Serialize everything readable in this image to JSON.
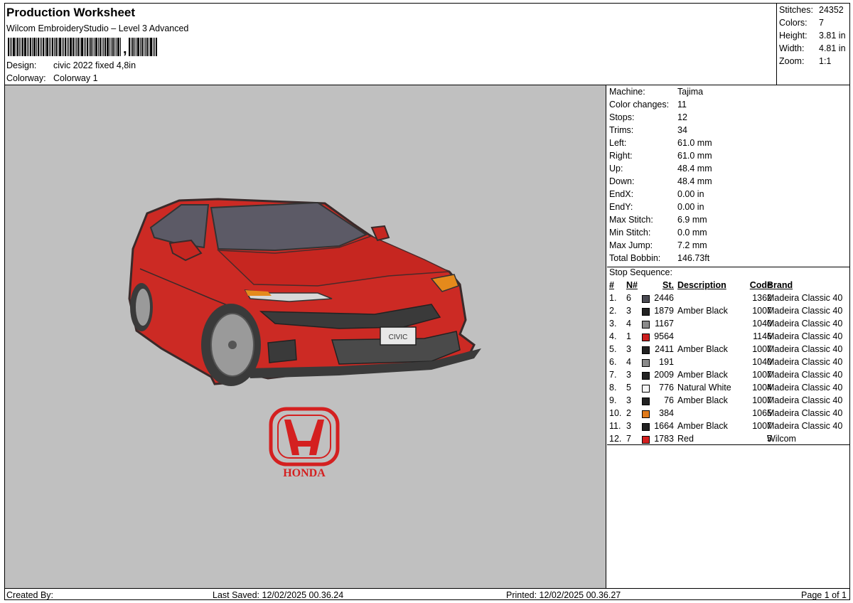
{
  "header": {
    "title": "Production Worksheet",
    "subtitle": "Wilcom EmbroideryStudio – Level 3 Advanced",
    "barcode_suffix": ",",
    "design_label": "Design:",
    "design_value": "civic 2022 fixed 4,8in",
    "colorway_label": "Colorway:",
    "colorway_value": "Colorway 1"
  },
  "stats": [
    {
      "label": "Stitches:",
      "value": "24352"
    },
    {
      "label": "Colors:",
      "value": "7"
    },
    {
      "label": "Height:",
      "value": "3.81 in"
    },
    {
      "label": "Width:",
      "value": "4.81 in"
    },
    {
      "label": "Zoom:",
      "value": "1:1"
    }
  ],
  "machine_info": [
    {
      "label": "Machine:",
      "value": "Tajima"
    },
    {
      "label": "Color changes:",
      "value": "11"
    },
    {
      "label": "Stops:",
      "value": "12"
    },
    {
      "label": "Trims:",
      "value": "34"
    },
    {
      "label": "Left:",
      "value": "61.0 mm"
    },
    {
      "label": "Right:",
      "value": "61.0 mm"
    },
    {
      "label": "Up:",
      "value": "48.4 mm"
    },
    {
      "label": "Down:",
      "value": "48.4 mm"
    },
    {
      "label": "EndX:",
      "value": "0.00 in"
    },
    {
      "label": "EndY:",
      "value": "0.00 in"
    },
    {
      "label": "Max Stitch:",
      "value": "6.9 mm"
    },
    {
      "label": "Min Stitch:",
      "value": "0.0 mm"
    },
    {
      "label": "Max Jump:",
      "value": "7.2 mm"
    },
    {
      "label": "Total Bobbin:",
      "value": "146.73ft"
    }
  ],
  "stop_sequence": {
    "title": "Stop Sequence:",
    "headers": {
      "num": "#",
      "n": "N#",
      "st": "St.",
      "description": "Description",
      "code": "Code",
      "brand": "Brand"
    },
    "rows": [
      {
        "num": "1.",
        "n": "6",
        "color": "#4a4a52",
        "st": "2446",
        "description": "",
        "code": "1362",
        "brand": "Madeira Classic 40"
      },
      {
        "num": "2.",
        "n": "3",
        "color": "#222222",
        "st": "1879",
        "description": "Amber Black",
        "code": "1007",
        "brand": "Madeira Classic 40"
      },
      {
        "num": "3.",
        "n": "4",
        "color": "#8a8a8a",
        "st": "1167",
        "description": "",
        "code": "1040",
        "brand": "Madeira Classic 40"
      },
      {
        "num": "4.",
        "n": "1",
        "color": "#cc1f1f",
        "st": "9564",
        "description": "",
        "code": "1146",
        "brand": "Madeira Classic 40"
      },
      {
        "num": "5.",
        "n": "3",
        "color": "#222222",
        "st": "2411",
        "description": "Amber Black",
        "code": "1007",
        "brand": "Madeira Classic 40"
      },
      {
        "num": "6.",
        "n": "4",
        "color": "#8a8a8a",
        "st": "191",
        "description": "",
        "code": "1040",
        "brand": "Madeira Classic 40"
      },
      {
        "num": "7.",
        "n": "3",
        "color": "#222222",
        "st": "2009",
        "description": "Amber Black",
        "code": "1007",
        "brand": "Madeira Classic 40"
      },
      {
        "num": "8.",
        "n": "5",
        "color": "#f4f4f4",
        "st": "776",
        "description": "Natural White",
        "code": "1004",
        "brand": "Madeira Classic 40"
      },
      {
        "num": "9.",
        "n": "3",
        "color": "#222222",
        "st": "76",
        "description": "Amber Black",
        "code": "1007",
        "brand": "Madeira Classic 40"
      },
      {
        "num": "10.",
        "n": "2",
        "color": "#e07a1a",
        "st": "384",
        "description": "",
        "code": "1065",
        "brand": "Madeira Classic 40"
      },
      {
        "num": "11.",
        "n": "3",
        "color": "#222222",
        "st": "1664",
        "description": "Amber Black",
        "code": "1007",
        "brand": "Madeira Classic 40"
      },
      {
        "num": "12.",
        "n": "7",
        "color": "#d42020",
        "st": "1783",
        "description": "Red",
        "code": "5",
        "brand": "Wilcom"
      }
    ]
  },
  "design_preview": {
    "logo_text": "HONDA",
    "plate_text": "CIVIC"
  },
  "footer": {
    "created_by": "Created By:",
    "last_saved": "Last Saved: 12/02/2025 00.36.24",
    "printed": "Printed: 12/02/2025 00.36.27",
    "page": "Page 1 of 1"
  },
  "colors": {
    "canvas_bg": "#c0c0c0",
    "car_red": "#cc2a24",
    "logo_red": "#d42020"
  }
}
